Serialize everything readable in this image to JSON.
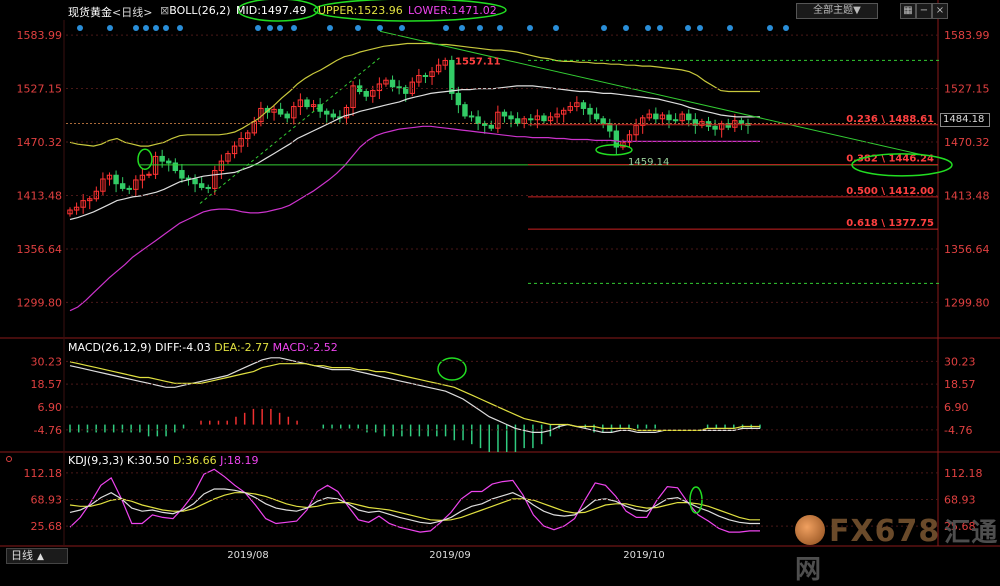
{
  "header": {
    "instrument": "现货黄金",
    "period": "<日线>",
    "boll_label": "BOLL(26,2)",
    "mid": "MID:1497.49",
    "upper": "UPPER:1523.96",
    "lower": "LOWER:1471.02",
    "theme_button": "全部主题▼",
    "period_tab": "日线"
  },
  "colors": {
    "background": "#000000",
    "up_candle": "#ff3333",
    "down_candle": "#33cc66",
    "boll_upper": "#c8c83c",
    "boll_mid": "#dddddd",
    "boll_lower": "#cc33cc",
    "trendline": "#33cc33",
    "fib": "#cc2222",
    "annotation": "#22dd22",
    "diff": "#dddddd",
    "dea": "#e0e040",
    "macd": "#ee44ee",
    "axis_text": "#e04040",
    "grid": "#4a1818"
  },
  "chart_data": [
    {
      "type": "candlestick",
      "title": "现货黄金 <日线> BOLL(26,2)",
      "x_labels": [
        "2019/08",
        "2019/09",
        "2019/10"
      ],
      "y_ticks": [
        1583.99,
        1527.15,
        1470.32,
        1413.48,
        1356.64,
        1299.8
      ],
      "ylim": [
        1262,
        1600
      ],
      "close": [
        1398,
        1401,
        1408,
        1410,
        1418,
        1431,
        1435,
        1426,
        1421,
        1420,
        1430,
        1435,
        1436,
        1455,
        1450,
        1448,
        1440,
        1432,
        1431,
        1426,
        1422,
        1421,
        1440,
        1450,
        1458,
        1466,
        1474,
        1480,
        1492,
        1506,
        1502,
        1505,
        1500,
        1496,
        1508,
        1515,
        1508,
        1510,
        1503,
        1500,
        1497,
        1496,
        1507,
        1530,
        1524,
        1519,
        1525,
        1532,
        1536,
        1529,
        1528,
        1522,
        1534,
        1541,
        1540,
        1545,
        1552,
        1557,
        1522,
        1510,
        1498,
        1497,
        1490,
        1488,
        1485,
        1502,
        1498,
        1495,
        1490,
        1495,
        1494,
        1498,
        1493,
        1497,
        1500,
        1504,
        1508,
        1512,
        1506,
        1500,
        1495,
        1490,
        1482,
        1465,
        1470,
        1478,
        1488,
        1496,
        1500,
        1495,
        1499,
        1494,
        1493,
        1500,
        1494,
        1488,
        1492,
        1487,
        1484,
        1490,
        1486,
        1493,
        1490,
        1488
      ],
      "boll_upper": {
        "name": "UPPER",
        "values": [
          1470,
          1468,
          1467,
          1466,
          1468,
          1472,
          1474,
          1470,
          1468,
          1466,
          1466,
          1468,
          1470,
          1474,
          1477,
          1478,
          1478,
          1478,
          1478,
          1478,
          1479,
          1481,
          1485,
          1490,
          1495,
          1502,
          1509,
          1517,
          1524,
          1532,
          1538,
          1543,
          1547,
          1552,
          1557,
          1561,
          1563,
          1566,
          1568,
          1570,
          1572,
          1573,
          1574,
          1575,
          1575,
          1575,
          1575,
          1574,
          1574,
          1573,
          1572,
          1571,
          1570,
          1569,
          1568,
          1568,
          1567,
          1566,
          1564,
          1562,
          1560,
          1559,
          1557,
          1556,
          1556,
          1555,
          1555,
          1554,
          1554,
          1553,
          1553,
          1552,
          1552,
          1551,
          1551,
          1550,
          1549,
          1548,
          1547,
          1545,
          1541,
          1535,
          1530,
          1525,
          1524,
          1524,
          1524,
          1524,
          1524
        ]
      },
      "boll_mid": {
        "name": "MID",
        "values": [
          1388,
          1390,
          1393,
          1396,
          1400,
          1404,
          1408,
          1410,
          1412,
          1413,
          1415,
          1417,
          1420,
          1424,
          1428,
          1430,
          1432,
          1434,
          1435,
          1436,
          1437,
          1438,
          1441,
          1444,
          1448,
          1453,
          1458,
          1463,
          1468,
          1474,
          1478,
          1482,
          1486,
          1490,
          1494,
          1498,
          1500,
          1503,
          1505,
          1507,
          1509,
          1511,
          1513,
          1516,
          1518,
          1520,
          1522,
          1523,
          1524,
          1525,
          1526,
          1526,
          1527,
          1527,
          1527,
          1528,
          1529,
          1530,
          1530,
          1530,
          1529,
          1528,
          1527,
          1526,
          1525,
          1524,
          1524,
          1523,
          1522,
          1522,
          1521,
          1520,
          1519,
          1518,
          1517,
          1516,
          1514,
          1512,
          1510,
          1507,
          1505,
          1503,
          1501,
          1499,
          1498,
          1497,
          1497,
          1497,
          1497
        ]
      },
      "boll_lower": {
        "name": "LOWER",
        "values": [
          1291,
          1295,
          1302,
          1310,
          1318,
          1326,
          1333,
          1340,
          1348,
          1354,
          1360,
          1366,
          1372,
          1378,
          1384,
          1388,
          1392,
          1396,
          1398,
          1399,
          1399,
          1398,
          1396,
          1395,
          1395,
          1396,
          1398,
          1400,
          1403,
          1408,
          1413,
          1418,
          1424,
          1430,
          1437,
          1445,
          1455,
          1465,
          1472,
          1477,
          1480,
          1482,
          1484,
          1485,
          1486,
          1487,
          1487,
          1486,
          1485,
          1484,
          1483,
          1482,
          1481,
          1480,
          1479,
          1478,
          1477,
          1476,
          1476,
          1475,
          1475,
          1475,
          1474,
          1474,
          1473,
          1473,
          1473,
          1472,
          1472,
          1472,
          1471,
          1471,
          1471,
          1471,
          1471,
          1471,
          1471,
          1471,
          1471,
          1471,
          1471,
          1471,
          1471,
          1471,
          1471,
          1471,
          1471,
          1471,
          1471
        ]
      },
      "fib_levels": [
        {
          "ratio": "0.236",
          "price": 1488.61,
          "label": "0.236 \\ 1488.61"
        },
        {
          "ratio": "0.382",
          "price": 1446.24,
          "label": "0.382 \\ 1446.24"
        },
        {
          "ratio": "0.500",
          "price": 1412.0,
          "label": "0.500 \\ 1412.00"
        },
        {
          "ratio": "0.618",
          "price": 1377.75,
          "label": "0.618 \\ 1377.75"
        }
      ],
      "fib_top": 1557.11,
      "fib_bottom": 1320,
      "annotations": {
        "high_label": "1557.11",
        "low_label": "1459.14",
        "current_price": "1484.18"
      }
    },
    {
      "type": "line",
      "title": "MACD(26,12,9)",
      "labels": {
        "diff": "DIFF:-4.03",
        "dea": "DEA:-2.77",
        "macd": "MACD:-2.52"
      },
      "y_ticks": [
        30.23,
        18.57,
        6.9,
        -4.76
      ],
      "ylim": [
        -15,
        36
      ],
      "series": [
        {
          "name": "DIFF",
          "values": [
            28,
            27,
            26,
            25,
            24,
            23,
            22,
            21,
            20,
            19,
            18,
            17,
            17,
            18,
            19,
            20,
            21,
            22,
            23,
            25,
            27,
            29,
            31,
            32,
            32,
            31,
            30,
            29,
            28,
            27,
            26,
            26,
            26,
            25,
            24,
            23,
            22,
            21,
            20,
            19,
            18,
            17,
            16,
            15,
            13,
            11,
            8,
            5,
            2,
            0,
            -2,
            -4,
            -5,
            -6,
            -6,
            -5,
            -3,
            -2,
            -3,
            -4,
            -5,
            -6,
            -6,
            -5,
            -5,
            -6,
            -6,
            -6,
            -5,
            -5,
            -5,
            -5,
            -5,
            -5,
            -5,
            -5,
            -5,
            -4,
            -4,
            -4
          ]
        },
        {
          "name": "DEA",
          "values": [
            30,
            29,
            28,
            27,
            26,
            25,
            24,
            23,
            22,
            22,
            21,
            20,
            19,
            19,
            19,
            19,
            20,
            21,
            22,
            23,
            24,
            25,
            27,
            28,
            29,
            29,
            29,
            29,
            28,
            28,
            27,
            27,
            27,
            26,
            26,
            25,
            25,
            24,
            23,
            22,
            21,
            20,
            19,
            18,
            17,
            15,
            13,
            11,
            9,
            7,
            5,
            3,
            1,
            0,
            -1,
            -2,
            -2,
            -2,
            -3,
            -3,
            -3,
            -4,
            -4,
            -4,
            -4,
            -5,
            -5,
            -5,
            -5,
            -5,
            -5,
            -5,
            -5,
            -4,
            -4,
            -4,
            -4,
            -3,
            -3,
            -3
          ]
        },
        {
          "name": "MACD",
          "values": [
            -4,
            -4,
            -4,
            -4,
            -4,
            -4,
            -4,
            -4,
            -4,
            -6,
            -6,
            -6,
            -4,
            -2,
            0,
            2,
            2,
            2,
            2,
            4,
            6,
            8,
            8,
            8,
            6,
            4,
            2,
            0,
            0,
            -2,
            -2,
            -2,
            -2,
            -2,
            -4,
            -4,
            -6,
            -6,
            -6,
            -6,
            -6,
            -6,
            -6,
            -6,
            -8,
            -8,
            -10,
            -12,
            -14,
            -14,
            -14,
            -14,
            -12,
            -12,
            -10,
            -6,
            -2,
            0,
            0,
            -2,
            -4,
            -4,
            -4,
            -2,
            -2,
            -2,
            -2,
            -2,
            0,
            0,
            0,
            0,
            0,
            -2,
            -2,
            -2,
            -2,
            -2,
            -2,
            -2
          ]
        }
      ]
    },
    {
      "type": "line",
      "title": "KDJ(9,3,3)",
      "labels": {
        "k": "K:30.50",
        "d": "D:36.66",
        "j": "J:18.19"
      },
      "y_ticks": [
        112.18,
        68.93,
        25.68
      ],
      "ylim": [
        0,
        125
      ],
      "series": [
        {
          "name": "K",
          "values": [
            48,
            52,
            60,
            72,
            80,
            70,
            55,
            50,
            52,
            48,
            46,
            52,
            62,
            78,
            86,
            86,
            84,
            80,
            72,
            62,
            55,
            52,
            50,
            55,
            66,
            72,
            70,
            62,
            52,
            48,
            50,
            45,
            40,
            36,
            32,
            30,
            34,
            40,
            50,
            58,
            62,
            70,
            75,
            80,
            72,
            60,
            50,
            44,
            42,
            44,
            55,
            68,
            70,
            66,
            58,
            52,
            50,
            60,
            70,
            72,
            64,
            56,
            50,
            42,
            36,
            32,
            30,
            30
          ]
        },
        {
          "name": "D",
          "values": [
            60,
            58,
            58,
            62,
            68,
            70,
            66,
            60,
            56,
            52,
            50,
            50,
            54,
            62,
            70,
            76,
            80,
            80,
            78,
            74,
            68,
            62,
            58,
            56,
            58,
            62,
            64,
            64,
            60,
            56,
            54,
            52,
            48,
            44,
            40,
            36,
            35,
            36,
            40,
            46,
            52,
            58,
            64,
            70,
            70,
            68,
            62,
            56,
            50,
            47,
            48,
            54,
            60,
            62,
            62,
            58,
            55,
            56,
            60,
            64,
            64,
            62,
            58,
            52,
            46,
            40,
            36,
            36
          ]
        },
        {
          "name": "J",
          "values": [
            24,
            40,
            64,
            92,
            104,
            70,
            30,
            30,
            44,
            40,
            38,
            56,
            78,
            110,
            118,
            106,
            92,
            80,
            60,
            38,
            30,
            32,
            34,
            52,
            82,
            92,
            82,
            58,
            36,
            32,
            42,
            30,
            24,
            20,
            16,
            18,
            32,
            48,
            70,
            82,
            82,
            94,
            98,
            100,
            76,
            44,
            26,
            20,
            26,
            38,
            68,
            96,
            92,
            74,
            50,
            40,
            40,
            68,
            90,
            88,
            64,
            44,
            34,
            22,
            16,
            16,
            18,
            18
          ]
        }
      ]
    }
  ]
}
